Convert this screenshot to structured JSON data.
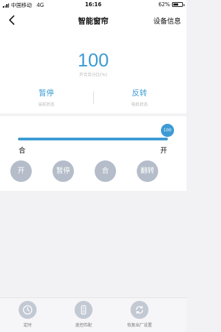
{
  "status_bar": {
    "carrier": "中国移动",
    "network": "4G",
    "time": "16:16",
    "battery_percent": "62%",
    "battery_level": 0.62
  },
  "nav": {
    "title": "智能窗帘",
    "right_label": "设备信息"
  },
  "panel": {
    "percent_value": "100",
    "percent_label": "开合百分比(%)",
    "current_state_value": "暂停",
    "current_state_label": "当前状态",
    "motor_state_value": "反转",
    "motor_state_label": "电机状态"
  },
  "slider": {
    "value": 100,
    "value_label": "100",
    "min_label": "合",
    "max_label": "开"
  },
  "controls": [
    {
      "label": "开"
    },
    {
      "label": "暂停"
    },
    {
      "label": "合"
    },
    {
      "label": "翻转"
    }
  ],
  "bottom_bar": [
    {
      "label": "定时",
      "icon": "clock-icon"
    },
    {
      "label": "遥控匹配",
      "icon": "remote-control-icon"
    },
    {
      "label": "恢复出厂设置",
      "icon": "factory-reset-icon"
    }
  ],
  "colors": {
    "accent": "#3c9bd4",
    "control_button": "#b4bdc9",
    "background": "#f2f2f4"
  }
}
